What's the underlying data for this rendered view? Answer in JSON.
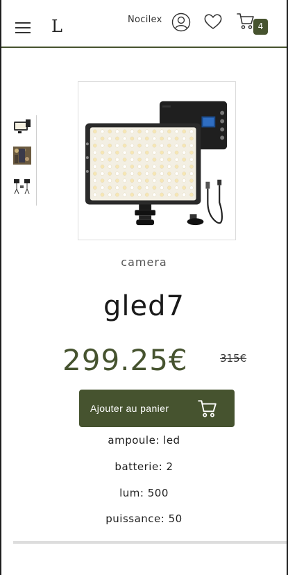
{
  "header": {
    "logo": "L",
    "username": "Nocilex",
    "cart_count": "4",
    "icons": [
      "menu-icon",
      "user-icon",
      "heart-icon",
      "cart-icon"
    ]
  },
  "product": {
    "category": "camera",
    "name": "gled7",
    "price": "299.25€",
    "old_price": "315€",
    "add_to_cart_label": "Ajouter au panier",
    "thumbnails": [
      "thumbnail-led-panel",
      "thumbnail-bokeh",
      "thumbnail-tripod-lights"
    ],
    "specs": [
      "ampoule: led",
      "batterie: 2",
      "lum: 500",
      "puissance: 50"
    ]
  },
  "colors": {
    "accent": "#46532f",
    "text": "#1e1e1e"
  }
}
